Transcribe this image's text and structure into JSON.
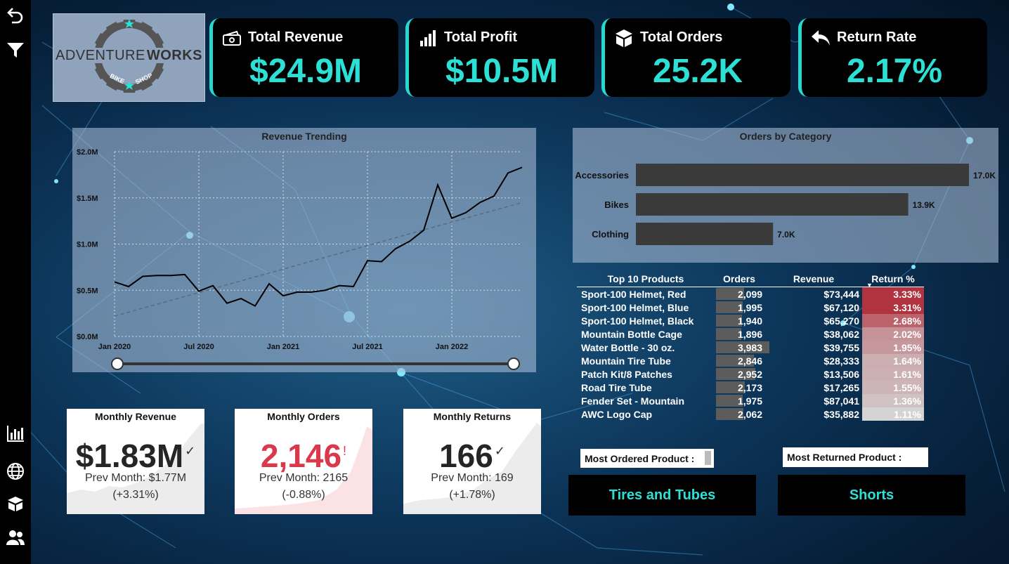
{
  "kpis": [
    {
      "title": "Total Revenue",
      "value": "$24.9M",
      "icon": "money-icon"
    },
    {
      "title": "Total Profit",
      "value": "$10.5M",
      "icon": "signal-bars-icon"
    },
    {
      "title": "Total Orders",
      "value": "25.2K",
      "icon": "box-icon"
    },
    {
      "title": "Return Rate",
      "value": "2.17%",
      "icon": "return-arrow-icon"
    }
  ],
  "logo": {
    "text_left": "ADVENTURE",
    "text_right": "WORKS",
    "sub_left": "BIKE",
    "sub_right": "SHOP"
  },
  "sidebar": {
    "icons": [
      "back-arrow-icon",
      "filter-icon",
      "bar-chart-icon",
      "globe-icon",
      "box-icon",
      "users-icon"
    ]
  },
  "revenue_chart": {
    "title": "Revenue Trending"
  },
  "category_chart": {
    "title": "Orders by Category"
  },
  "chart_data": [
    {
      "type": "line",
      "title": "Revenue Trending",
      "x": [
        "2020-01",
        "2020-02",
        "2020-03",
        "2020-04",
        "2020-05",
        "2020-06",
        "2020-07",
        "2020-08",
        "2020-09",
        "2020-10",
        "2020-11",
        "2020-12",
        "2021-01",
        "2021-02",
        "2021-03",
        "2021-04",
        "2021-05",
        "2021-06",
        "2021-07",
        "2021-08",
        "2021-09",
        "2021-10",
        "2021-11",
        "2021-12",
        "2022-01",
        "2022-02",
        "2022-03",
        "2022-04",
        "2022-05",
        "2022-06"
      ],
      "x_tick_labels": [
        "Jan 2020",
        "Jul 2020",
        "Jan 2021",
        "Jul 2021",
        "Jan 2022"
      ],
      "series": [
        {
          "values": [
            0.59,
            0.54,
            0.65,
            0.66,
            0.66,
            0.67,
            0.49,
            0.55,
            0.36,
            0.41,
            0.33,
            0.57,
            0.44,
            0.48,
            0.48,
            0.5,
            0.55,
            0.54,
            0.82,
            0.81,
            0.95,
            1.03,
            1.15,
            1.64,
            1.28,
            1.34,
            1.45,
            1.52,
            1.77,
            1.83
          ]
        }
      ],
      "trendline": {
        "style": "dashed",
        "start": 0.22,
        "end": 1.45
      },
      "y_tick_labels": [
        "$0.0M",
        "$0.5M",
        "$1.0M",
        "$1.5M",
        "$2.0M"
      ],
      "ylim": [
        0,
        2.0
      ],
      "grid": true
    },
    {
      "type": "bar",
      "orientation": "horizontal",
      "title": "Orders by Category",
      "categories": [
        "Accessories",
        "Bikes",
        "Clothing"
      ],
      "values": [
        17.0,
        13.9,
        7.0
      ],
      "value_labels": [
        "17.0K",
        "13.9K",
        "7.0K"
      ],
      "xlim": [
        0,
        17.0
      ]
    }
  ],
  "top10": {
    "headers": [
      "Top 10 Products",
      "Orders",
      "Revenue",
      "Return %"
    ],
    "sort_indicator": "▼",
    "rows": [
      {
        "product": "Sport-100 Helmet, Red",
        "orders": "2,099",
        "orders_n": 2099,
        "revenue": "$73,444",
        "ret": "3.33%",
        "ret_n": 3.33
      },
      {
        "product": "Sport-100 Helmet, Blue",
        "orders": "1,995",
        "orders_n": 1995,
        "revenue": "$67,120",
        "ret": "3.31%",
        "ret_n": 3.31
      },
      {
        "product": "Sport-100 Helmet, Black",
        "orders": "1,940",
        "orders_n": 1940,
        "revenue": "$65,270",
        "ret": "2.68%",
        "ret_n": 2.68
      },
      {
        "product": "Mountain Bottle Cage",
        "orders": "1,896",
        "orders_n": 1896,
        "revenue": "$38,062",
        "ret": "2.02%",
        "ret_n": 2.02
      },
      {
        "product": "Water Bottle - 30 oz.",
        "orders": "3,983",
        "orders_n": 3983,
        "revenue": "$39,755",
        "ret": "1.95%",
        "ret_n": 1.95
      },
      {
        "product": "Mountain Tire Tube",
        "orders": "2,846",
        "orders_n": 2846,
        "revenue": "$28,333",
        "ret": "1.64%",
        "ret_n": 1.64
      },
      {
        "product": "Patch Kit/8 Patches",
        "orders": "2,952",
        "orders_n": 2952,
        "revenue": "$13,506",
        "ret": "1.61%",
        "ret_n": 1.61
      },
      {
        "product": "Road Tire Tube",
        "orders": "2,173",
        "orders_n": 2173,
        "revenue": "$17,265",
        "ret": "1.55%",
        "ret_n": 1.55
      },
      {
        "product": "Fender Set - Mountain",
        "orders": "1,975",
        "orders_n": 1975,
        "revenue": "$87,041",
        "ret": "1.36%",
        "ret_n": 1.36
      },
      {
        "product": "AWC Logo Cap",
        "orders": "2,062",
        "orders_n": 2062,
        "revenue": "$35,882",
        "ret": "1.11%",
        "ret_n": 1.11
      }
    ]
  },
  "cards": [
    {
      "title": "Monthly Revenue",
      "value": "$1.83M",
      "flag": "✓",
      "flag_color": "#333333",
      "value_color": "#252525",
      "prev": "Prev Month: $1.77M",
      "pct": "(+3.31%)",
      "spark_color": "#e6e6e6"
    },
    {
      "title": "Monthly Orders",
      "value": "2,146",
      "flag": "!",
      "flag_color": "#d9394a",
      "value_color": "#d9394a",
      "prev": "Prev Month: 2165",
      "pct": "(-0.88%)",
      "spark_color": "#fbe3e5"
    },
    {
      "title": "Monthly Returns",
      "value": "166",
      "flag": "✓",
      "flag_color": "#333333",
      "value_color": "#252525",
      "prev": "Prev Month: 169",
      "pct": "(+1.78%)",
      "spark_color": "#e6e6e6"
    }
  ],
  "most_ordered": {
    "label": "Most Ordered Product :",
    "value": "Tires and Tubes"
  },
  "most_returned": {
    "label": "Most Returned Product :",
    "value": "Shorts"
  },
  "colors": {
    "accent": "#2de0d6",
    "kpi_bg": "#000000",
    "bar": "#3a3a3a",
    "return_high": "#b0333f",
    "return_low": "#d4d4d4"
  }
}
